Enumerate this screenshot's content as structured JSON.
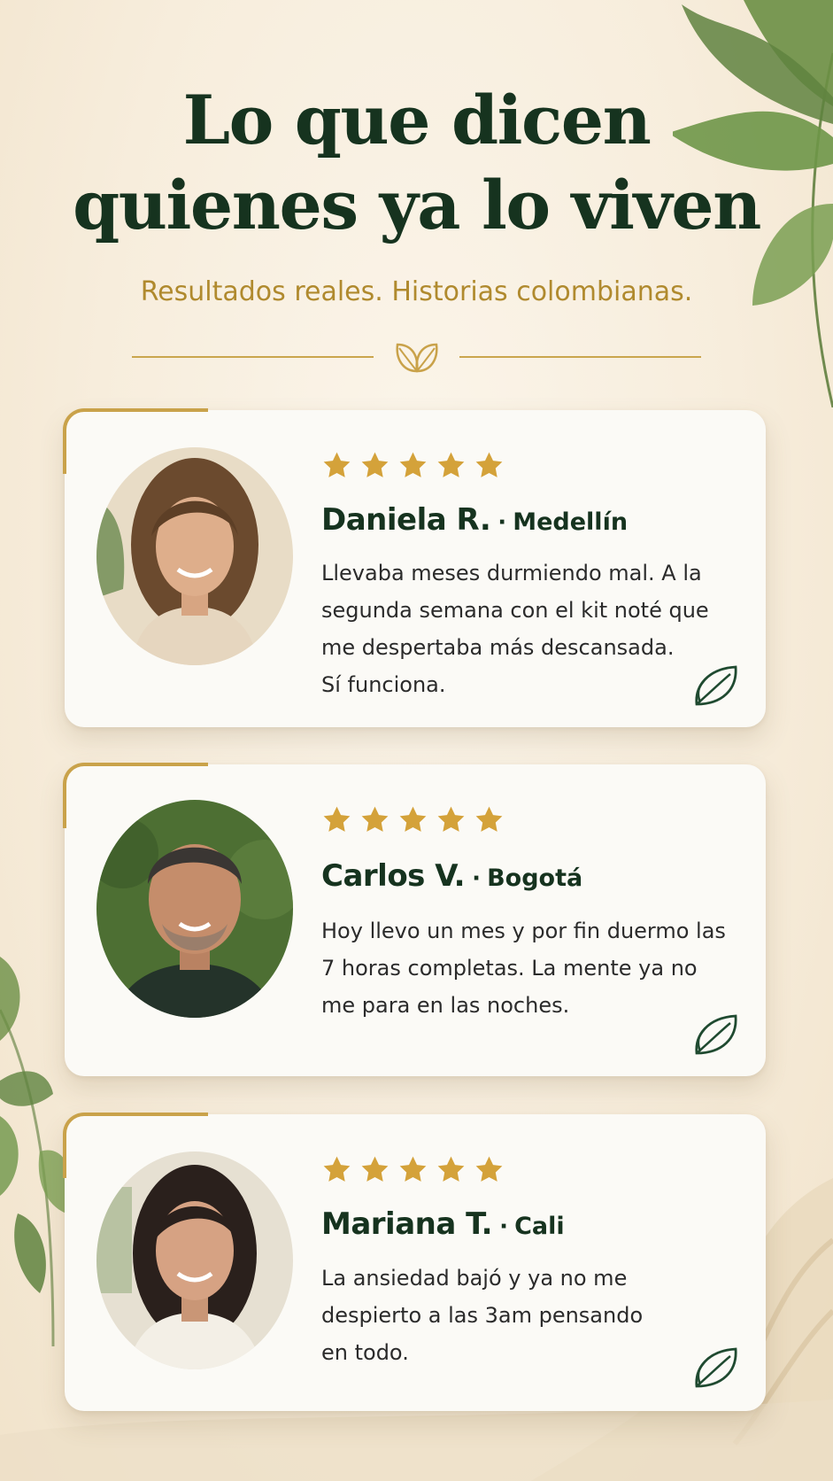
{
  "header": {
    "title_line1": "Lo que dicen",
    "title_line2": "quienes ya lo viven",
    "subtitle": "Resultados reales. Historias colombianas."
  },
  "testimonials": [
    {
      "rating": 5,
      "name": "Daniela R.",
      "separator": "·",
      "city": "Medellín",
      "quote_lines": [
        "Llevaba meses durmiendo mal. A la",
        "segunda semana con el kit noté que",
        "me despertaba más descansada.",
        "Sí funciona."
      ]
    },
    {
      "rating": 5,
      "name": "Carlos V.",
      "separator": "·",
      "city": "Bogotá",
      "quote_lines": [
        "Hoy llevo un mes y por fin duermo las",
        "7 horas completas. La mente ya no",
        "me para en las noches."
      ]
    },
    {
      "rating": 5,
      "name": "Mariana T.",
      "separator": "·",
      "city": "Cali",
      "quote_lines": [
        "La ansiedad bajó y ya no me",
        "despierto a las 3am pensando",
        "en todo."
      ]
    }
  ],
  "colors": {
    "title": "#16331f",
    "gold_accent": "#b08a2e",
    "star": "#d4a23a",
    "card_background": "#fbfaf6",
    "page_background": "#f7eddc"
  },
  "icons": {
    "divider": "double-leaf-icon",
    "card_corner": "leaf-icon",
    "rating": "star-icon"
  }
}
